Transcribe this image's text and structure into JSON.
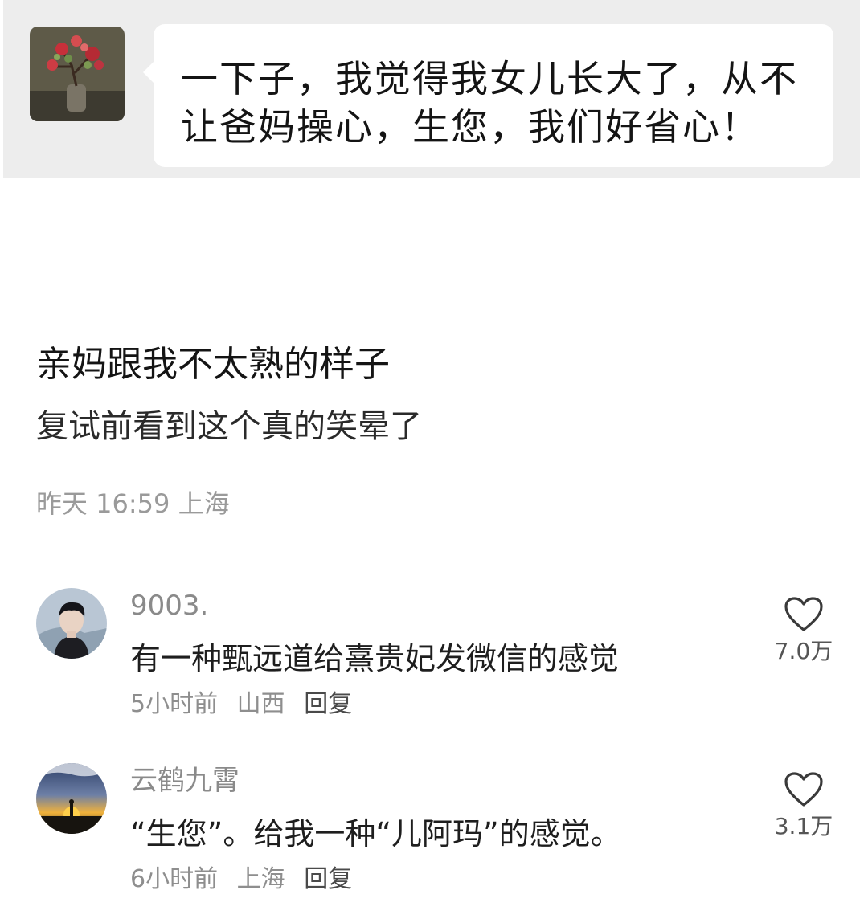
{
  "chat": {
    "message": "一下子，我觉得我女儿长大了，从不让爸妈操心，生您，我们好省心！"
  },
  "post": {
    "title": "亲妈跟我不太熟的样子",
    "body": "复试前看到这个真的笑晕了",
    "time": "昨天 16:59",
    "location": "上海"
  },
  "comments": [
    {
      "username": "9003.",
      "text": "有一种甄远道给熹贵妃发微信的感觉",
      "time": "5小时前",
      "location": "山西",
      "reply_label": "回复",
      "likes": "7.0万",
      "avatar_icon": "avatar-young-man"
    },
    {
      "username": "云鹤九霄",
      "text": "“生您”。给我一种“儿阿玛”的感觉。",
      "time": "6小时前",
      "location": "上海",
      "reply_label": "回复",
      "likes": "3.1万",
      "avatar_icon": "avatar-sunset-silhouette"
    }
  ],
  "icons": {
    "like": "heart-outline-icon"
  },
  "colors": {
    "chat_background": "#ededed",
    "meta_gray": "#9a9a9a"
  }
}
